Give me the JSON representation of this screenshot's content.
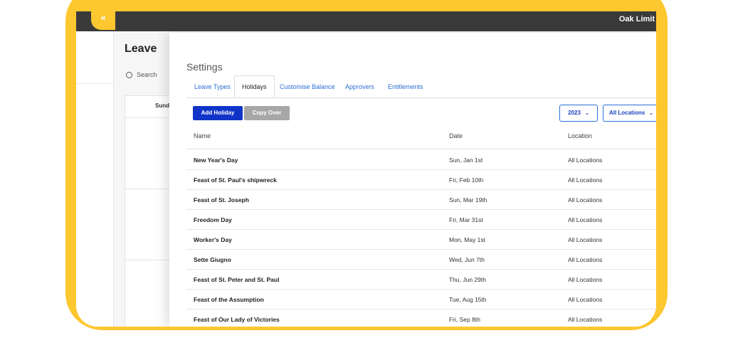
{
  "topbar": {
    "company": "Oak Limit"
  },
  "collapse_icon": "«",
  "leave_page": {
    "title": "Leave",
    "search_placeholder": "Search",
    "calendar_day": "Sunda"
  },
  "settings": {
    "title": "Settings",
    "tabs": [
      {
        "label": "Leave Types"
      },
      {
        "label": "Holidays"
      },
      {
        "label": "Customise Balance"
      },
      {
        "label": "Approvers"
      },
      {
        "label": "Entitlements"
      }
    ],
    "active_tab": "Holidays",
    "add_button": "Add Holiday",
    "copy_button": "Copy Over",
    "year_select": "2023",
    "location_select": "All Locations",
    "columns": [
      "Name",
      "Date",
      "Location"
    ],
    "rows": [
      {
        "name": "New Year's Day",
        "date": "Sun, Jan 1st",
        "location": "All Locations"
      },
      {
        "name": "Feast of St. Paul's shipwreck",
        "date": "Fri, Feb 10th",
        "location": "All Locations"
      },
      {
        "name": "Feast of St. Joseph",
        "date": "Sun, Mar 19th",
        "location": "All Locations"
      },
      {
        "name": "Freedom Day",
        "date": "Fri, Mar 31st",
        "location": "All Locations"
      },
      {
        "name": "Worker's Day",
        "date": "Mon, May 1st",
        "location": "All Locations"
      },
      {
        "name": "Sette Giugno",
        "date": "Wed, Jun 7th",
        "location": "All Locations"
      },
      {
        "name": "Feast of St. Peter and St. Paul",
        "date": "Thu, Jun 29th",
        "location": "All Locations"
      },
      {
        "name": "Feast of the Assumption",
        "date": "Tue, Aug 15th",
        "location": "All Locations"
      },
      {
        "name": "Feast of Our Lady of Victories",
        "date": "Fri, Sep 8th",
        "location": "All Locations"
      }
    ]
  },
  "colors": {
    "frame": "#fdc72f",
    "topbar": "#3a3a3a",
    "primary_button": "#1034c8",
    "secondary_button": "#a7a7a7",
    "link": "#2a6fd6"
  }
}
